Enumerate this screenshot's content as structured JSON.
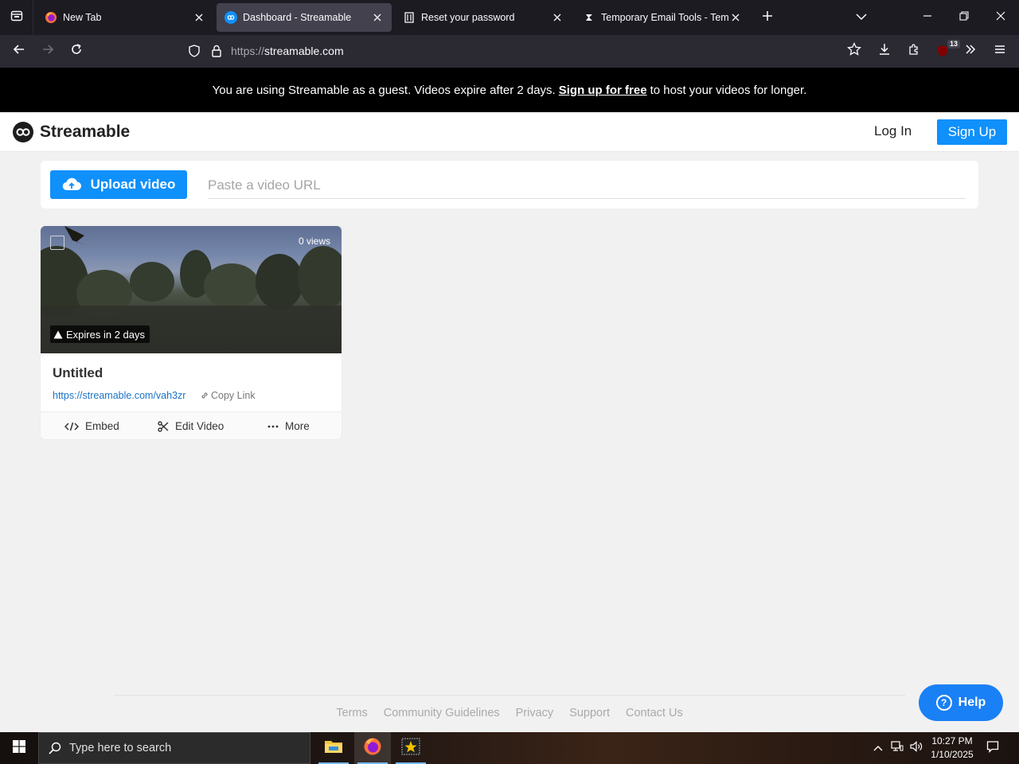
{
  "browser": {
    "tabs": [
      {
        "title": "New Tab",
        "active": false
      },
      {
        "title": "Dashboard - Streamable",
        "active": true
      },
      {
        "title": "Reset your password",
        "active": false
      },
      {
        "title": "Temporary Email Tools - Tempor",
        "active": false
      }
    ],
    "url_scheme": "https://",
    "url_host": "streamable.com",
    "extension_badge": "13"
  },
  "banner": {
    "prefix": "You are using Streamable as a guest. Videos expire after 2 days.",
    "link": "Sign up for free",
    "suffix": "to host your videos for longer."
  },
  "header": {
    "brand": "Streamable",
    "login": "Log In",
    "signup": "Sign Up"
  },
  "upload": {
    "button_label": "Upload video",
    "url_placeholder": "Paste a video URL"
  },
  "videos": [
    {
      "views": "0 views",
      "expires": "Expires in 2 days",
      "title": "Untitled",
      "link": "https://streamable.com/vah3zr",
      "copy_label": "Copy Link",
      "actions": {
        "embed": "Embed",
        "edit": "Edit Video",
        "more": "More"
      }
    }
  ],
  "footer": {
    "links": [
      "Terms",
      "Community Guidelines",
      "Privacy",
      "Support",
      "Contact Us"
    ]
  },
  "help": {
    "label": "Help"
  },
  "taskbar": {
    "search_placeholder": "Type here to search",
    "time": "10:27 PM",
    "date": "1/10/2025"
  },
  "colors": {
    "brand_blue": "#0f90fa",
    "help_blue": "#1a80f5",
    "banner_bg": "#000000",
    "link_blue": "#1a73c9"
  }
}
